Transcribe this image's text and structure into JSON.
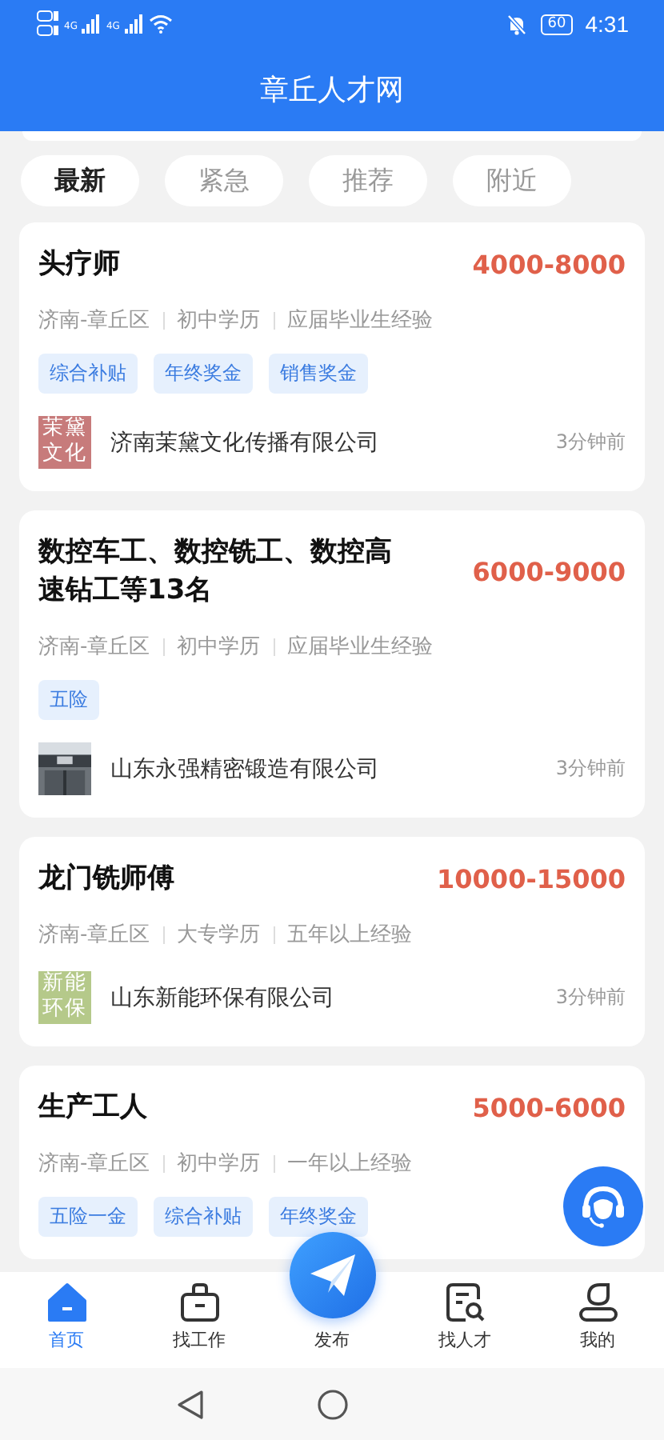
{
  "status_bar": {
    "network_labels": [
      "4G",
      "4G"
    ],
    "battery": "60",
    "time": "4:31"
  },
  "header": {
    "title": "章丘人才网"
  },
  "tabs": [
    {
      "label": "最新",
      "selected": true
    },
    {
      "label": "紧急",
      "selected": false
    },
    {
      "label": "推荐",
      "selected": false
    },
    {
      "label": "附近",
      "selected": false
    }
  ],
  "jobs": [
    {
      "title": "头疗师",
      "salary": "4000-8000",
      "meta": [
        "济南-章丘区",
        "初中学历",
        "应届毕业生经验"
      ],
      "tags": [
        "综合补贴",
        "年终奖金",
        "销售奖金"
      ],
      "company": "济南茉黛文化传播有限公司",
      "logo": {
        "kind": "text",
        "text": "茉黛文化",
        "color": "#c77b7b"
      },
      "time": "3分钟前"
    },
    {
      "title": "数控车工、数控铣工、数控高速钻工等13名",
      "salary": "6000-9000",
      "meta": [
        "济南-章丘区",
        "初中学历",
        "应届毕业生经验"
      ],
      "tags": [
        "五险"
      ],
      "company": "山东永强精密锻造有限公司",
      "logo": {
        "kind": "picture"
      },
      "time": "3分钟前"
    },
    {
      "title": "龙门铣师傅",
      "salary": "10000-15000",
      "meta": [
        "济南-章丘区",
        "大专学历",
        "五年以上经验"
      ],
      "company": "山东新能环保有限公司",
      "logo": {
        "kind": "text",
        "text": "新能环保",
        "color": "#b5c98a"
      },
      "time": "3分钟前"
    },
    {
      "title": "生产工人",
      "salary": "5000-6000",
      "meta": [
        "济南-章丘区",
        "初中学历",
        "一年以上经验"
      ],
      "tags": [
        "五险一金",
        "综合补贴",
        "年终奖金"
      ]
    }
  ],
  "nav": [
    {
      "label": "首页",
      "kind": "home",
      "selected": true
    },
    {
      "label": "找工作",
      "kind": "jobs",
      "selected": false
    },
    {
      "label": "发布",
      "kind": "publish",
      "selected": false
    },
    {
      "label": "找人才",
      "kind": "talent",
      "selected": false
    },
    {
      "label": "我的",
      "kind": "profile",
      "selected": false
    }
  ]
}
